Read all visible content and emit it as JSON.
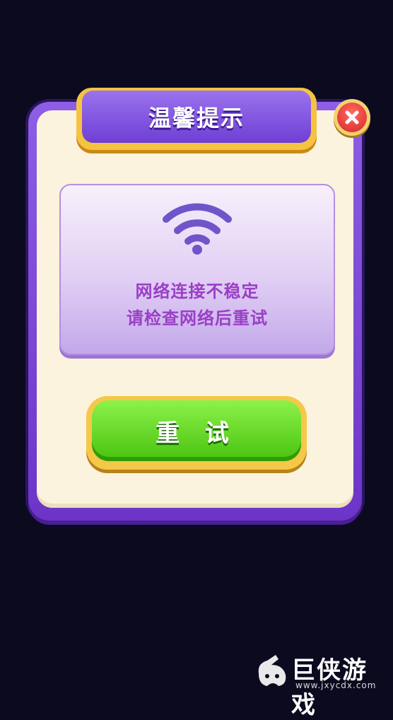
{
  "background": {
    "partial_title_text": "",
    "color": "#0b0a1f"
  },
  "dialog": {
    "title": "温馨提示",
    "close_icon": "close-x-icon",
    "message_line1": "网络连接不稳定",
    "message_line2": "请检查网络后重试",
    "status_icon": "wifi-icon",
    "retry_label": "重 试"
  },
  "colors": {
    "frame_purple": "#7a46d6",
    "title_gold": "#f6c341",
    "panel_cream": "#fbf3dd",
    "message_purple": "#9a3fc6",
    "button_green": "#5fd41f",
    "close_red": "#e1352f"
  },
  "watermark": {
    "text": "巨侠游戏",
    "url": "www.jxycdx.com"
  }
}
